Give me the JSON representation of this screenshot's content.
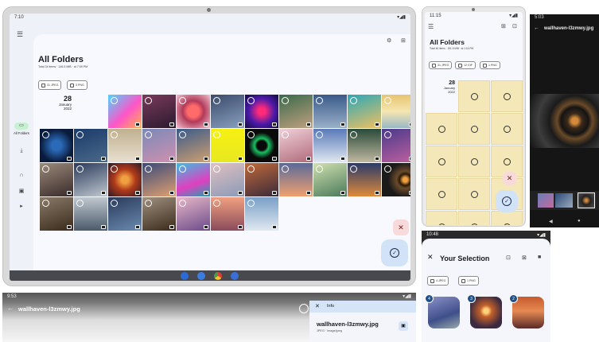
{
  "colors": {
    "accent": "#1f4f86",
    "fab_primary": "#d2e3f8",
    "fab_danger": "#f9dada",
    "nav_active": "#c7f0d0",
    "tile_placeholder": "#f4e7b8"
  },
  "tablet": {
    "status": {
      "time": "7:10",
      "icons": "▾◢▮"
    },
    "nav": {
      "active_label": "All Folders"
    },
    "header": {
      "title": "All Folders",
      "subtitle": "Total 34 items · 146.5 MiB · at 7:09 PM"
    },
    "chips": [
      {
        "label": "31 JPEG"
      },
      {
        "label": "3 PNG"
      }
    ],
    "date": {
      "day": "28",
      "month": "January",
      "year": "2022"
    },
    "dock": [
      "phone-app",
      "messages-app",
      "chrome-app",
      "camera-app"
    ]
  },
  "phone1": {
    "status": {
      "time": "11:15",
      "icons": "▾◢▮"
    },
    "header": {
      "title": "All Folders",
      "subtitle": "Total 46 items · 151.6 MiB · at 1:16 PM"
    },
    "chips": [
      {
        "label": "31 JPEG"
      },
      {
        "label": "12 GIF"
      },
      {
        "label": "1 PNG"
      }
    ],
    "date": {
      "day": "28",
      "month": "January",
      "year": "2022"
    }
  },
  "phone2": {
    "status": {
      "time": "5:03"
    },
    "title": "wallhaven-l3zmwy.jpg"
  },
  "phone3": {
    "status": {
      "time": "10:48",
      "icons": "▾◢▮"
    },
    "title": "Your Selection",
    "chips": [
      {
        "label": "4 JPEG"
      },
      {
        "label": "1 PNG"
      }
    ],
    "badges": [
      "4",
      "3",
      "2"
    ]
  },
  "landscape": {
    "status": {
      "time": "9:53",
      "icons": "▾◢▮"
    },
    "title": "wallhaven-l3zmwy.jpg",
    "info_label": "Info",
    "info_filename": "wallhaven-l3zmwy.jpg",
    "info_meta": "JPEG · image/jpeg"
  }
}
